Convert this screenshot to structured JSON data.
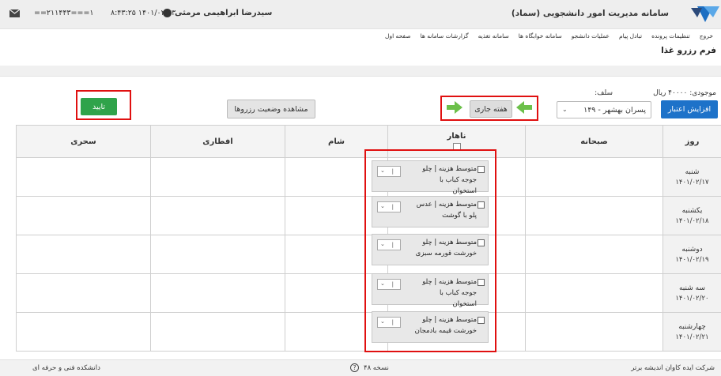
{
  "header": {
    "app_title": "سامانه مدیریت امور دانشجویی (سماد)",
    "user_name": "سیدرضا ابراهیمی مرمثی",
    "datetime": "۸:۴۳:۲۵  ۱۴۰۱/۰۲/۱۳",
    "user_id": "==۲۱۱۴۴۳===۱"
  },
  "nav": {
    "items": [
      "صفحه اول",
      "گزارشات سامانه ها",
      "سامانه تغذیه",
      "سامانه خوابگاه ها",
      "عملیات دانشجو",
      "تبادل پیام",
      "تنظیمات پرونده",
      "خروج"
    ]
  },
  "page_title": "فرم رزرو غذا",
  "controls": {
    "balance_label": "موجودی:",
    "balance_value": "۴۰۰۰۰ ریال",
    "self_label": "سلف:",
    "increase_credit": "افزایش اعتبار",
    "self_selected": "پسران بهشهر - ۱۴۹",
    "current_week": "هفته جاری",
    "reservation_status": "مشاهده وضعیت رزروها",
    "confirm": "تایید"
  },
  "table": {
    "headers": {
      "day": "روز",
      "breakfast": "صبحانه",
      "lunch": "ناهار",
      "dinner": "شام",
      "iftar": "افطاری",
      "sahari": "سحری"
    },
    "rows": [
      {
        "day": "شنبه",
        "date": "۱۴۰۱/۰۲/۱۷",
        "lunch": "متوسط هزینه | چلو جوجه کباب با استخوان"
      },
      {
        "day": "یکشنبه",
        "date": "۱۴۰۱/۰۲/۱۸",
        "lunch": "متوسط هزینه | عدس پلو با گوشت"
      },
      {
        "day": "دوشنبه",
        "date": "۱۴۰۱/۰۲/۱۹",
        "lunch": "متوسط هزینه | چلو خورشت قورمه سبزی"
      },
      {
        "day": "سه شنبه",
        "date": "۱۴۰۱/۰۲/۲۰",
        "lunch": "متوسط هزینه | چلو جوجه کباب با استخوان"
      },
      {
        "day": "چهارشنبه",
        "date": "۱۴۰۱/۰۲/۲۱",
        "lunch": "متوسط هزینه | چلو خورشت قیمه بادمجان"
      }
    ]
  },
  "footer": {
    "company": "شرکت ایده کاوان اندیشه برتر",
    "version": "نسخه ۴۸",
    "university": "دانشکده فنی و حرفه ای"
  },
  "colors": {
    "primary": "#1d72c9",
    "confirm": "#2fa34a",
    "highlight": "#e01010",
    "arrow": "#6cc04a"
  },
  "icons": [
    "logo-icon",
    "user-icon",
    "mail-icon",
    "arrow-right-icon",
    "arrow-left-icon",
    "help-icon",
    "chevron-down-icon"
  ]
}
